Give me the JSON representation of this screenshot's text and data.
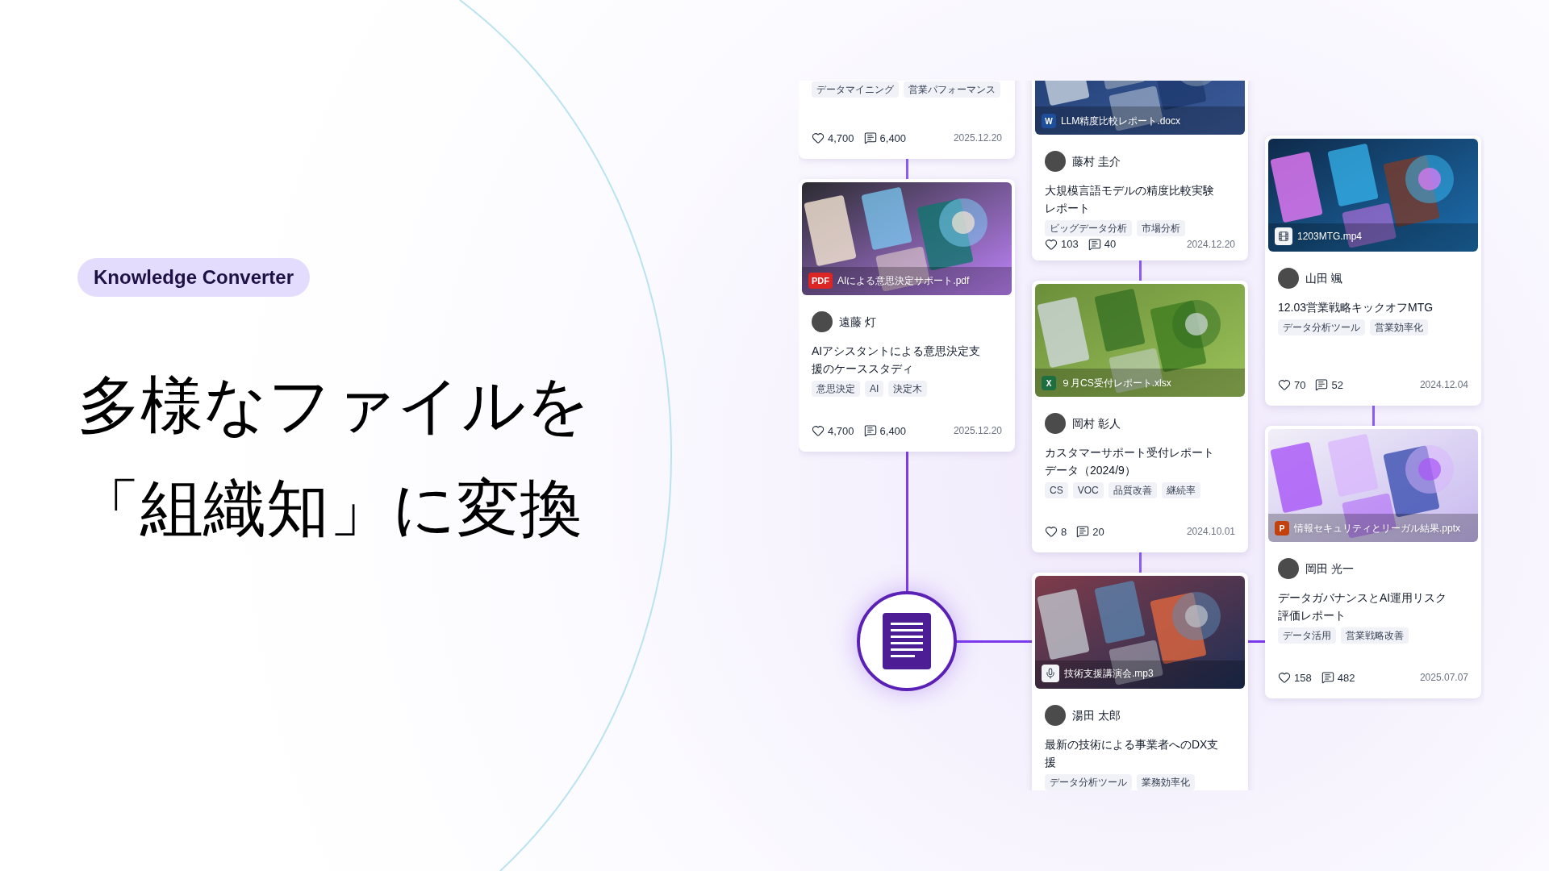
{
  "badge": "Knowledge Converter",
  "heading": [
    "多様なファイルを",
    "「組織知」に変換"
  ],
  "columns": [
    {
      "cards": [
        {
          "tags": [
            "データマイニング",
            "営業パフォーマンス"
          ],
          "likes": "4,700",
          "comments": "6,400",
          "date": "2025.12.20"
        },
        {
          "file": {
            "kind": "pdf",
            "badge": "PDF",
            "name": "AIによる意思決定サポート.pdf"
          },
          "author": "遠藤 灯",
          "title": "AIアシスタントによる意思決定支援のケーススタディ",
          "tags": [
            "意思決定",
            "AI",
            "決定木"
          ],
          "likes": "4,700",
          "comments": "6,400",
          "date": "2025.12.20"
        }
      ]
    },
    {
      "cards": [
        {
          "file": {
            "kind": "docx",
            "badge": "W",
            "name": "LLM精度比較レポート.docx"
          },
          "author": "藤村 圭介",
          "title": "大規模言語モデルの精度比較実験レポート",
          "tags": [
            "ビッグデータ分析",
            "市場分析"
          ],
          "likes": "103",
          "comments": "40",
          "date": "2024.12.20"
        },
        {
          "file": {
            "kind": "xlsx",
            "badge": "X",
            "name": "９月CS受付レポート.xlsx"
          },
          "author": "岡村 彰人",
          "title": "カスタマーサポート受付レポートデータ（2024/9）",
          "tags": [
            "CS",
            "VOC",
            "品質改善",
            "継続率"
          ],
          "likes": "8",
          "comments": "20",
          "date": "2024.10.01"
        },
        {
          "file": {
            "kind": "mp3",
            "name": "技術支援講演会.mp3"
          },
          "author": "湯田 太郎",
          "title": "最新の技術による事業者へのDX支援",
          "tags": [
            "データ分析ツール",
            "業務効率化"
          ]
        }
      ]
    },
    {
      "cards": [
        {
          "file": {
            "kind": "mp4",
            "name": "1203MTG.mp4"
          },
          "author": "山田 颯",
          "title": "12.03営業戦略キックオフMTG",
          "tags": [
            "データ分析ツール",
            "営業効率化"
          ],
          "likes": "70",
          "comments": "52",
          "date": "2024.12.04"
        },
        {
          "file": {
            "kind": "pptx",
            "badge": "P",
            "name": "情報セキュリティとリーガル結果.pptx"
          },
          "author": "岡田 光一",
          "title": "データガバナンスとAI運用リスク評価レポート",
          "tags": [
            "データ活用",
            "営業戦略改善"
          ],
          "likes": "158",
          "comments": "482",
          "date": "2025.07.07"
        }
      ]
    }
  ]
}
